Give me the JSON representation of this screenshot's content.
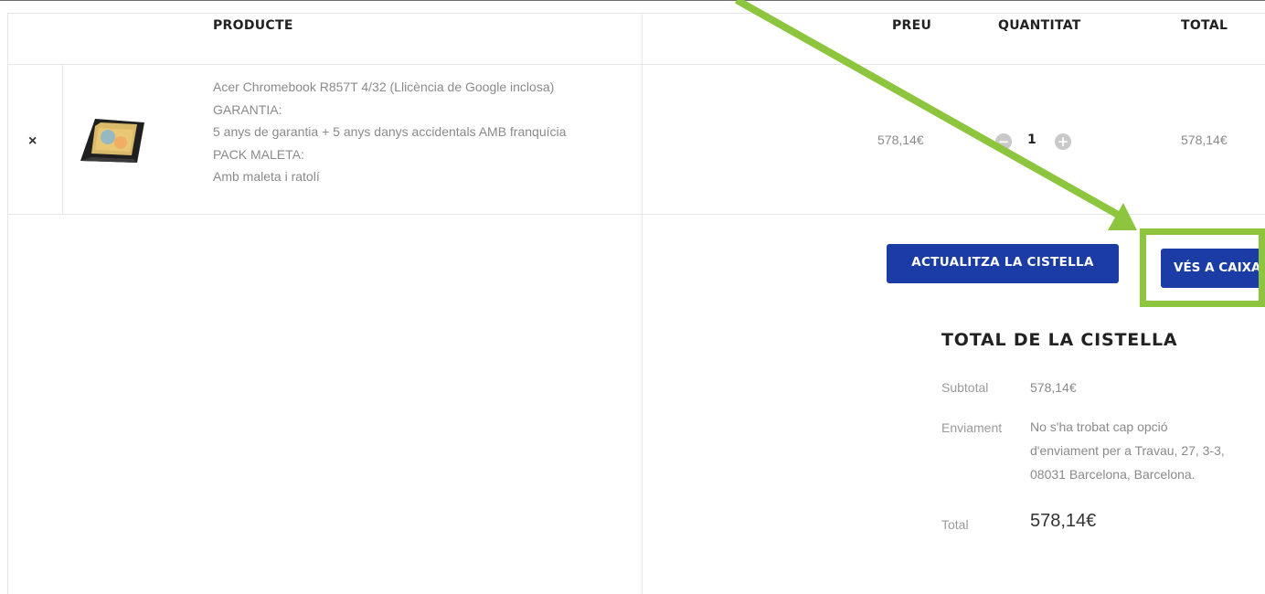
{
  "table": {
    "headers": {
      "product": "PRODUCTE",
      "price": "PREU",
      "quantity": "QUANTITAT",
      "total": "TOTAL"
    },
    "item": {
      "remove_icon": "×",
      "description_lines": [
        "Acer Chromebook R857T 4/32 (Llicència de Google inclosa)",
        "GARANTIA:",
        "5 anys de garantia + 5 anys danys accidentals AMB franquícia",
        "PACK MALETA:",
        "Amb maleta i ratolí"
      ],
      "price": "578,14€",
      "quantity": "1",
      "minus": "−",
      "plus": "+",
      "line_total": "578,14€"
    }
  },
  "actions": {
    "update_cart": "ACTUALITZA LA CISTELLA",
    "checkout": "VÉS A CAIXA"
  },
  "totals": {
    "title": "TOTAL DE LA CISTELLA",
    "subtotal_label": "Subtotal",
    "subtotal_value": "578,14€",
    "shipping_label": "Enviament",
    "shipping_lines": [
      "No s'ha trobat cap opció",
      "d'enviament per a Travau, 27, 3-3,",
      "08031 Barcelona, Barcelona."
    ],
    "total_label": "Total",
    "total_value": "578,14€"
  },
  "colors": {
    "button": "#1b3ca5",
    "highlight": "#8dc53e"
  }
}
